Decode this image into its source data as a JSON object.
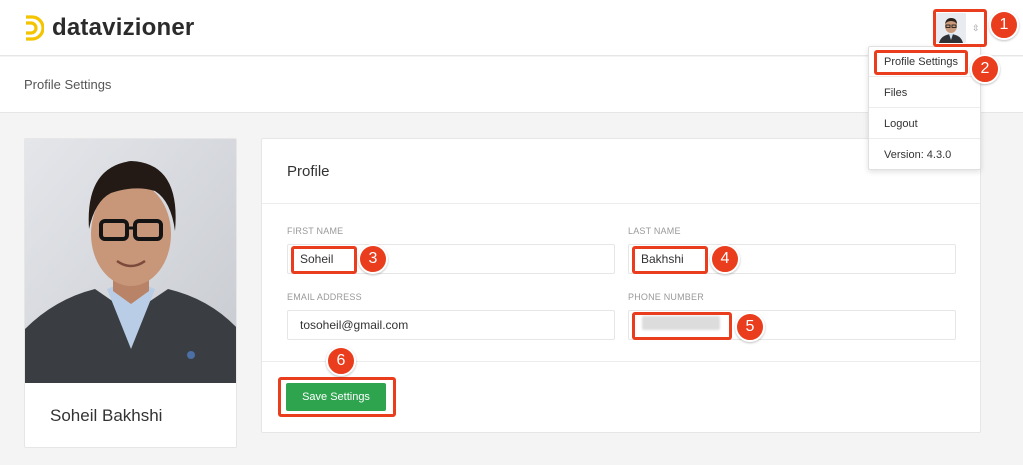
{
  "app": {
    "name": "datavizioner"
  },
  "breadcrumb": "Profile Settings",
  "user_menu": {
    "items": [
      "Profile Settings",
      "Files",
      "Logout",
      "Version: 4.3.0"
    ]
  },
  "profile": {
    "name": "Soheil Bakhshi"
  },
  "form": {
    "title": "Profile",
    "fields": {
      "first_name": {
        "label": "FIRST NAME",
        "value": "Soheil"
      },
      "last_name": {
        "label": "LAST NAME",
        "value": "Bakhshi"
      },
      "email": {
        "label": "EMAIL ADDRESS",
        "value": "tosoheil@gmail.com"
      },
      "phone": {
        "label": "PHONE NUMBER",
        "value": ""
      }
    },
    "save_label": "Save Settings"
  },
  "annotations": [
    "1",
    "2",
    "3",
    "4",
    "5",
    "6"
  ],
  "colors": {
    "accent": "#ea3d1d",
    "save_button": "#2ea44f",
    "logo": "#f5c400"
  }
}
